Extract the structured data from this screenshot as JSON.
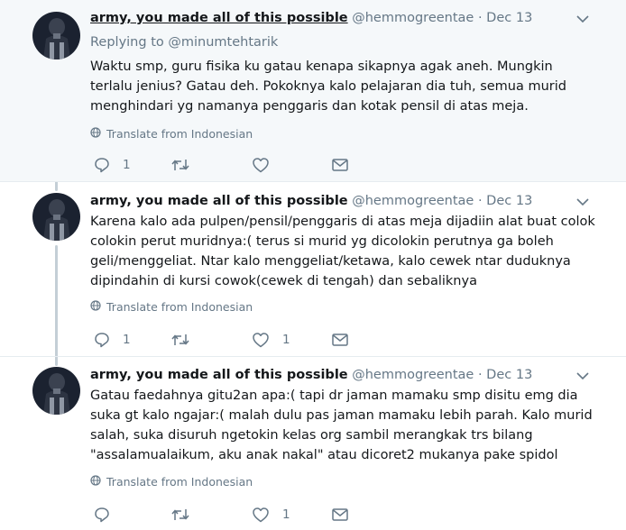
{
  "tweets": [
    {
      "name": "army, you made all of this possible",
      "handle": "@hemmogreentae",
      "dot": "·",
      "date": "Dec 13",
      "reply_to_prefix": "Replying to",
      "reply_to_handle": "@minumtehtarik",
      "text": "Waktu smp, guru fisika ku gatau kenapa sikapnya agak aneh. Mungkin terlalu jenius? Gatau deh. Pokoknya kalo pelajaran dia tuh, semua murid menghindari yg namanya penggaris dan kotak pensil di atas meja.",
      "translate_label": "Translate from Indonesian",
      "reply_count": "1",
      "retweet_count": "",
      "like_count": ""
    },
    {
      "name": "army, you made all of this possible",
      "handle": "@hemmogreentae",
      "dot": "·",
      "date": "Dec 13",
      "text": "Karena kalo ada pulpen/pensil/penggaris di atas meja dijadiin alat buat colok colokin perut muridnya:( terus si murid yg dicolokin perutnya ga boleh geli/menggeliat. Ntar kalo menggeliat/ketawa, kalo cewek ntar duduknya dipindahin di kursi cowok(cewek di tengah) dan sebaliknya",
      "translate_label": "Translate from Indonesian",
      "reply_count": "1",
      "retweet_count": "",
      "like_count": "1"
    },
    {
      "name": "army, you made all of this possible",
      "handle": "@hemmogreentae",
      "dot": "·",
      "date": "Dec 13",
      "text": "Gatau faedahnya gitu2an apa:( tapi dr jaman mamaku smp disitu emg dia suka gt kalo ngajar:( malah dulu pas jaman mamaku lebih parah. Kalo murid salah, suka disuruh ngetokin kelas org sambil merangkak trs bilang \"assalamualaikum, aku anak nakal\" atau dicoret2 mukanya pake spidol",
      "translate_label": "Translate from Indonesian",
      "reply_count": "",
      "retweet_count": "",
      "like_count": "1"
    }
  ],
  "colors": {
    "text": "#14171a",
    "secondary": "#657786",
    "highlight_bg": "#f5f8fa",
    "thread_line": "#c4cfd6",
    "divider": "#e6ecf0"
  },
  "icons": [
    "avatar",
    "chevron-down-icon",
    "globe-icon",
    "reply-icon",
    "retweet-icon",
    "like-icon",
    "message-icon"
  ]
}
